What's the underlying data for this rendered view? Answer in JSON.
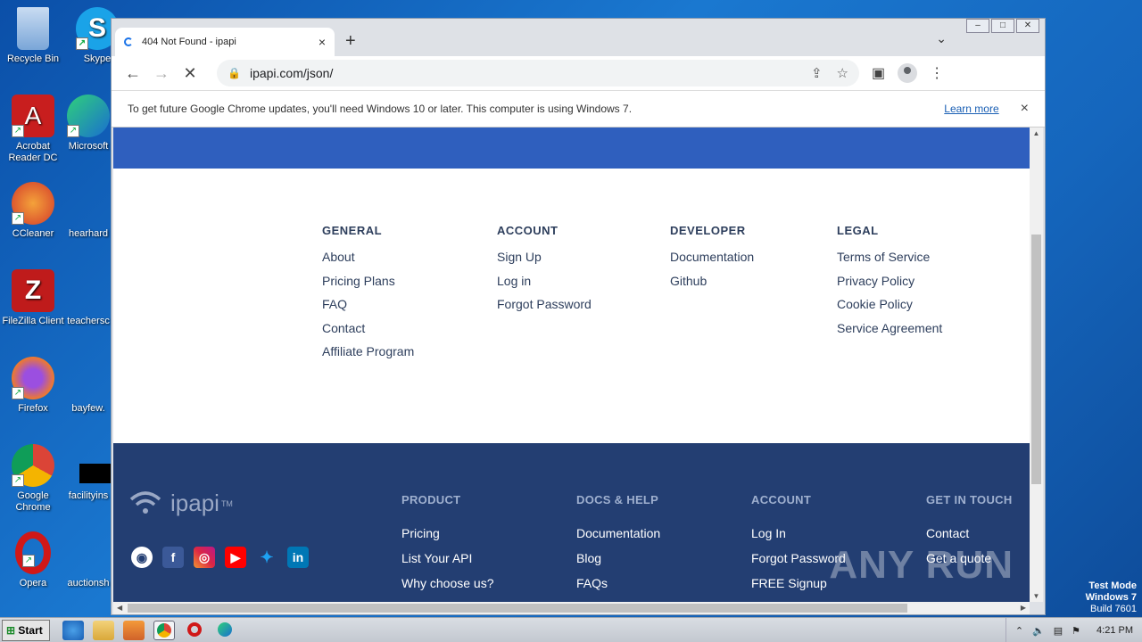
{
  "desktop": {
    "icons": [
      {
        "label": "Recycle Bin",
        "color": "#6a9bd8"
      },
      {
        "label": "Skype",
        "color": "#1aa3e8"
      },
      {
        "label": "Acrobat Reader DC",
        "color": "#c81e1e"
      },
      {
        "label": "Microsoft",
        "color": "#1a6fd0"
      },
      {
        "label": "CCleaner",
        "color": "#d33a2a"
      },
      {
        "label": "hearhard",
        "color": "#ffffff"
      },
      {
        "label": "FileZilla Client",
        "color": "#bf1b1b"
      },
      {
        "label": "teachersc",
        "color": "#ffffff"
      },
      {
        "label": "Firefox",
        "color": "#f07a2a"
      },
      {
        "label": "bayfew.",
        "color": "#ffffff"
      },
      {
        "label": "Google Chrome",
        "color": "#2a9a4a"
      },
      {
        "label": "facilityins",
        "color": "#000000"
      },
      {
        "label": "Opera",
        "color": "#d01818"
      },
      {
        "label": "auctionsh",
        "color": "#ffffff"
      }
    ],
    "watermark": {
      "line1": "Test Mode",
      "line2": "Windows 7",
      "line3": "Build 7601"
    }
  },
  "browser": {
    "tab_title": "404 Not Found - ipapi",
    "tab_close": "×",
    "new_tab": "+",
    "url": "ipapi.com/json/",
    "infobar": {
      "message": "To get future Google Chrome updates, you'll need Windows 10 or later. This computer is using Windows 7.",
      "link": "Learn more",
      "close": "×"
    }
  },
  "footer_light": {
    "columns": [
      {
        "heading": "GENERAL",
        "links": [
          "About",
          "Pricing Plans",
          "FAQ",
          "Contact",
          "Affiliate Program"
        ]
      },
      {
        "heading": "ACCOUNT",
        "links": [
          "Sign Up",
          "Log in",
          "Forgot Password"
        ]
      },
      {
        "heading": "DEVELOPER",
        "links": [
          "Documentation",
          "Github"
        ]
      },
      {
        "heading": "LEGAL",
        "links": [
          "Terms of Service",
          "Privacy Policy",
          "Cookie Policy",
          "Service Agreement"
        ]
      }
    ]
  },
  "footer_dark": {
    "logo_text": "ipapi",
    "logo_tm": "TM",
    "columns": [
      {
        "heading": "PRODUCT",
        "links": [
          "Pricing",
          "List Your API",
          "Why choose us?"
        ]
      },
      {
        "heading": "DOCS & HELP",
        "links": [
          "Documentation",
          "Blog",
          "FAQs"
        ]
      },
      {
        "heading": "ACCOUNT",
        "links": [
          "Log In",
          "Forgot Password",
          "FREE Signup"
        ]
      },
      {
        "heading": "GET IN TOUCH",
        "links": [
          "Contact",
          "Get a quote"
        ]
      }
    ],
    "watermark": "ANY RUN"
  },
  "taskbar": {
    "start_label": "Start",
    "clock": "4:21 PM"
  }
}
